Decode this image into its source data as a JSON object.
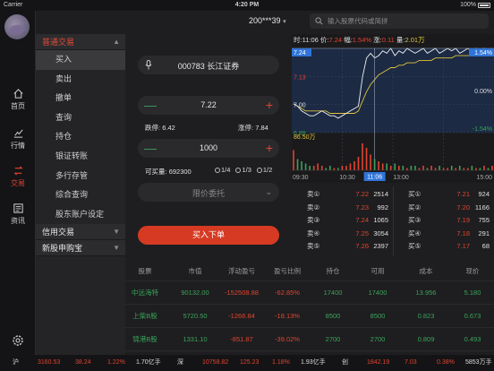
{
  "statusbar": {
    "carrier": "Carrier",
    "time": "4:20 PM",
    "battery": "100%"
  },
  "header": {
    "account": "200***39",
    "search_placeholder": "输入股票代码或简拼"
  },
  "leftnav": {
    "items": [
      {
        "label": "首页"
      },
      {
        "label": "行情"
      },
      {
        "label": "交易"
      },
      {
        "label": "资讯"
      }
    ],
    "active": "交易"
  },
  "menu": {
    "sections": [
      {
        "label": "普通交易",
        "items": [
          "买入",
          "卖出",
          "撤单",
          "查询",
          "持仓",
          "银证转账",
          "多行存管",
          "综合查询",
          "股东账户设定"
        ]
      },
      {
        "label": "信用交易"
      },
      {
        "label": "新股申购宝"
      }
    ]
  },
  "trade": {
    "stock": "000783 长江证券",
    "price": "7.22",
    "limit_down_label": "跌停:",
    "limit_down": "6.42",
    "limit_up_label": "涨停:",
    "limit_up": "7.84",
    "qty": "1000",
    "avail_label": "可买量:",
    "avail": "692300",
    "ratios": [
      "1/4",
      "1/3",
      "1/2"
    ],
    "order_type": "限价委托",
    "submit": "买入下单"
  },
  "chart_data": {
    "type": "line",
    "info": {
      "time_label": "时:",
      "time": "11:06",
      "price_label": "价:",
      "price": "7.24",
      "pct_label": "幅:",
      "pct": "1.54%",
      "chg_label": "涨:",
      "chg": "0.11",
      "amt_label": "量:",
      "amt": "2.01万"
    },
    "yaxis_left": [
      "7.24",
      "7.13",
      "7.00",
      "6.89"
    ],
    "yaxis_right": [
      "1.54%",
      "0.00%",
      "-1.54%"
    ],
    "vol_label": "86.50万",
    "x_ticks": [
      "09:30",
      "10:30",
      "13:00",
      "15:00"
    ],
    "cursor_time": "11:06",
    "price_series": [
      7.01,
      7.0,
      6.98,
      6.97,
      6.96,
      6.96,
      6.97,
      6.98,
      6.97,
      6.96,
      6.96,
      6.95,
      6.96,
      6.97,
      6.98,
      6.99,
      7.0,
      7.12,
      7.2,
      7.22,
      7.2,
      7.21,
      7.23,
      7.22,
      7.24,
      7.21,
      7.23,
      7.22,
      7.24,
      7.23,
      7.22,
      7.23,
      7.24,
      7.22,
      7.23,
      7.24,
      7.22,
      7.23,
      7.24,
      7.23,
      7.24,
      7.22,
      7.23,
      7.24,
      7.23,
      7.24,
      7.22,
      7.24,
      7.23,
      7.24
    ],
    "avg_series": [
      7.01,
      7.0,
      6.99,
      6.98,
      6.98,
      6.98,
      6.98,
      6.98,
      6.98,
      6.97,
      6.97,
      6.97,
      6.97,
      6.97,
      6.97,
      6.97,
      6.98,
      7.02,
      7.06,
      7.09,
      7.11,
      7.13,
      7.14,
      7.15,
      7.16,
      7.16,
      7.17,
      7.17,
      7.18,
      7.18,
      7.18,
      7.19,
      7.19,
      7.19,
      7.19,
      7.2,
      7.2,
      7.2,
      7.2,
      7.2,
      7.21,
      7.21,
      7.21,
      7.21,
      7.21,
      7.21,
      7.21,
      7.22,
      7.22,
      7.22
    ],
    "volume_series": [
      9,
      5,
      4,
      3,
      2,
      2,
      3,
      2,
      1,
      2,
      1,
      1,
      2,
      2,
      3,
      4,
      6,
      12,
      10,
      7,
      5,
      4,
      3,
      3,
      2,
      3,
      2,
      2,
      1,
      2,
      2,
      1,
      2,
      1,
      2,
      1,
      2,
      1,
      1,
      2,
      1,
      2,
      1,
      1,
      2,
      1,
      1,
      2,
      1,
      2
    ],
    "ylim": [
      6.89,
      7.24
    ]
  },
  "orderbook": {
    "sell": [
      {
        "label": "卖⑤",
        "price": "7.26",
        "vol": "2397"
      },
      {
        "label": "卖④",
        "price": "7.25",
        "vol": "3054"
      },
      {
        "label": "卖③",
        "price": "7.24",
        "vol": "1065"
      },
      {
        "label": "卖②",
        "price": "7.23",
        "vol": "992"
      },
      {
        "label": "卖①",
        "price": "7.22",
        "vol": "2514"
      }
    ],
    "buy": [
      {
        "label": "买①",
        "price": "7.21",
        "vol": "924"
      },
      {
        "label": "买②",
        "price": "7.20",
        "vol": "1166"
      },
      {
        "label": "买③",
        "price": "7.19",
        "vol": "755"
      },
      {
        "label": "买④",
        "price": "7.18",
        "vol": "291"
      },
      {
        "label": "买⑤",
        "price": "7.17",
        "vol": "68"
      }
    ]
  },
  "holdings": {
    "headers": [
      "股票",
      "市值",
      "浮动盈亏",
      "盈亏比例",
      "持仓",
      "可用",
      "成本",
      "现价"
    ],
    "rows": [
      [
        "中远海特",
        "90132.00",
        "-152508.88",
        "-62.85%",
        "17400",
        "17400",
        "13.956",
        "5.180"
      ],
      [
        "上柴B股",
        "5720.50",
        "-1266.84",
        "-18.13%",
        "8500",
        "8500",
        "0.823",
        "0.673"
      ],
      [
        "锦港B股",
        "1331.10",
        "-851.87",
        "-39.02%",
        "2700",
        "2700",
        "0.809",
        "0.493"
      ]
    ]
  },
  "ticker": [
    {
      "name": "沪",
      "value": "3160.53",
      "chg": "38.24",
      "pct": "1.22%",
      "amount": "1.70亿手"
    },
    {
      "name": "深",
      "value": "10758.82",
      "chg": "125.23",
      "pct": "1.18%",
      "amount": "1.93亿手"
    },
    {
      "name": "创",
      "value": "1842.19",
      "chg": "7.03",
      "pct": "0.38%",
      "amount": "5853万手"
    }
  ]
}
